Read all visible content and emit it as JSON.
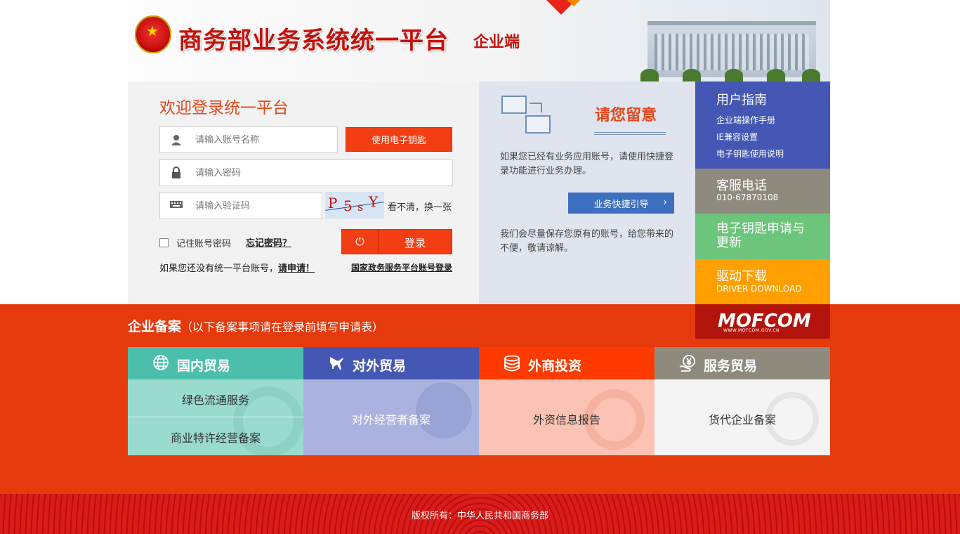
{
  "header": {
    "title": "商务部业务系统统一平台",
    "subtitle": "企业端"
  },
  "login": {
    "welcome": "欢迎登录统一平台",
    "username_placeholder": "请输入账号名称",
    "password_placeholder": "请输入密码",
    "captcha_placeholder": "请输入验证码",
    "ukey_button": "使用电子钥匙",
    "captcha_text": "P5sY",
    "refresh_captcha": "看不清，换一张",
    "remember_label": "记住账号密码",
    "forgot_label": "忘记密码？",
    "login_button": "登录",
    "no_account_text": "如果您还没有统一平台账号，",
    "apply_link": "请申请！",
    "gov_login": "国家政务服务平台账号登录"
  },
  "notice": {
    "title": "请您留意",
    "para1": "如果您已经有业务应用账号，请使用快捷登录功能进行业务办理。",
    "guide_button": "业务快捷引导",
    "para2": "我们会尽量保存您原有的账号，给您带来的不便，敬请谅解。"
  },
  "side": {
    "guide_title": "用户指南",
    "guide_links": [
      "企业端操作手册",
      "IE兼容设置",
      "电子钥匙使用说明"
    ],
    "phone_title": "客服电话",
    "phone_number": "010-67870108",
    "ukey_title": "电子钥匙申请与更新",
    "driver_title": "驱动下载",
    "driver_sub": "DRIVER DOWNLOAD",
    "mofcom_logo": "MOFCOM",
    "mofcom_url": "WWW.MOFCOM.GOV.CN"
  },
  "filing": {
    "title": "企业备案",
    "note": "（以下备案事项请在登录前填写申请表）",
    "categories": [
      {
        "label": "国内贸易",
        "icon": "globe-icon",
        "items": [
          "绿色流通服务",
          "商业特许经营备案"
        ]
      },
      {
        "label": "对外贸易",
        "icon": "plane-icon",
        "items": [
          "对外经营者备案"
        ]
      },
      {
        "label": "外商投资",
        "icon": "coins-icon",
        "items": [
          "外资信息报告"
        ]
      },
      {
        "label": "服务贸易",
        "icon": "yuan-hand-icon",
        "items": [
          "货代企业备案"
        ]
      }
    ]
  },
  "footer": {
    "copyright": "版权所有：中华人民共和国商务部"
  },
  "colors": {
    "brand_red": "#e53a0c",
    "accent_orange": "#f33e14",
    "guide_blue": "#4457b4",
    "teal": "#4bbfab",
    "gray": "#8f8a7e",
    "green": "#6cc57b",
    "amber": "#ffa000"
  }
}
